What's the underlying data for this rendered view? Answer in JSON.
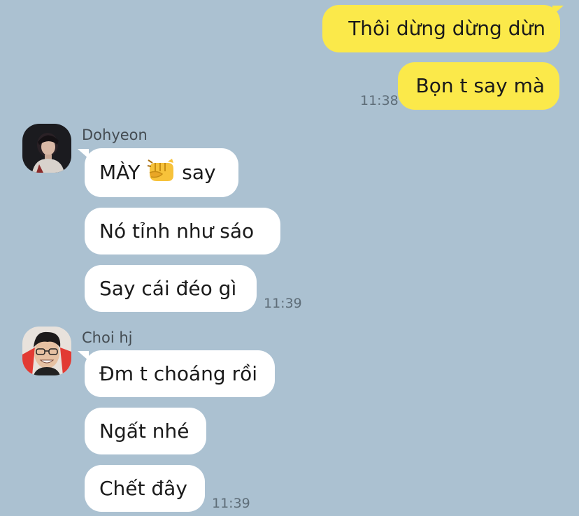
{
  "messages_outgoing": [
    {
      "text": "Thôi dừng dừng dừn"
    },
    {
      "text": "Bọn t say mà",
      "time": "11:38"
    }
  ],
  "groups": [
    {
      "sender": "Dohyeon",
      "avatar_icon": "user-avatar-dohyeon",
      "messages": [
        {
          "text_before": "MÀY",
          "emoji": "oncoming-fist-emoji",
          "text_after": "say"
        },
        {
          "text": "Nó tỉnh như sáo"
        },
        {
          "text": "Say cái đéo gì",
          "time": "11:39"
        }
      ]
    },
    {
      "sender": "Choi hj",
      "avatar_icon": "user-avatar-choi-hj",
      "messages": [
        {
          "text": "Đm t choáng rồi"
        },
        {
          "text": "Ngất nhé"
        },
        {
          "text": "Chết đây",
          "time": "11:39"
        }
      ]
    }
  ],
  "colors": {
    "background": "#abc1d1",
    "outgoing_bubble": "#fbe94a",
    "incoming_bubble": "#ffffff"
  }
}
